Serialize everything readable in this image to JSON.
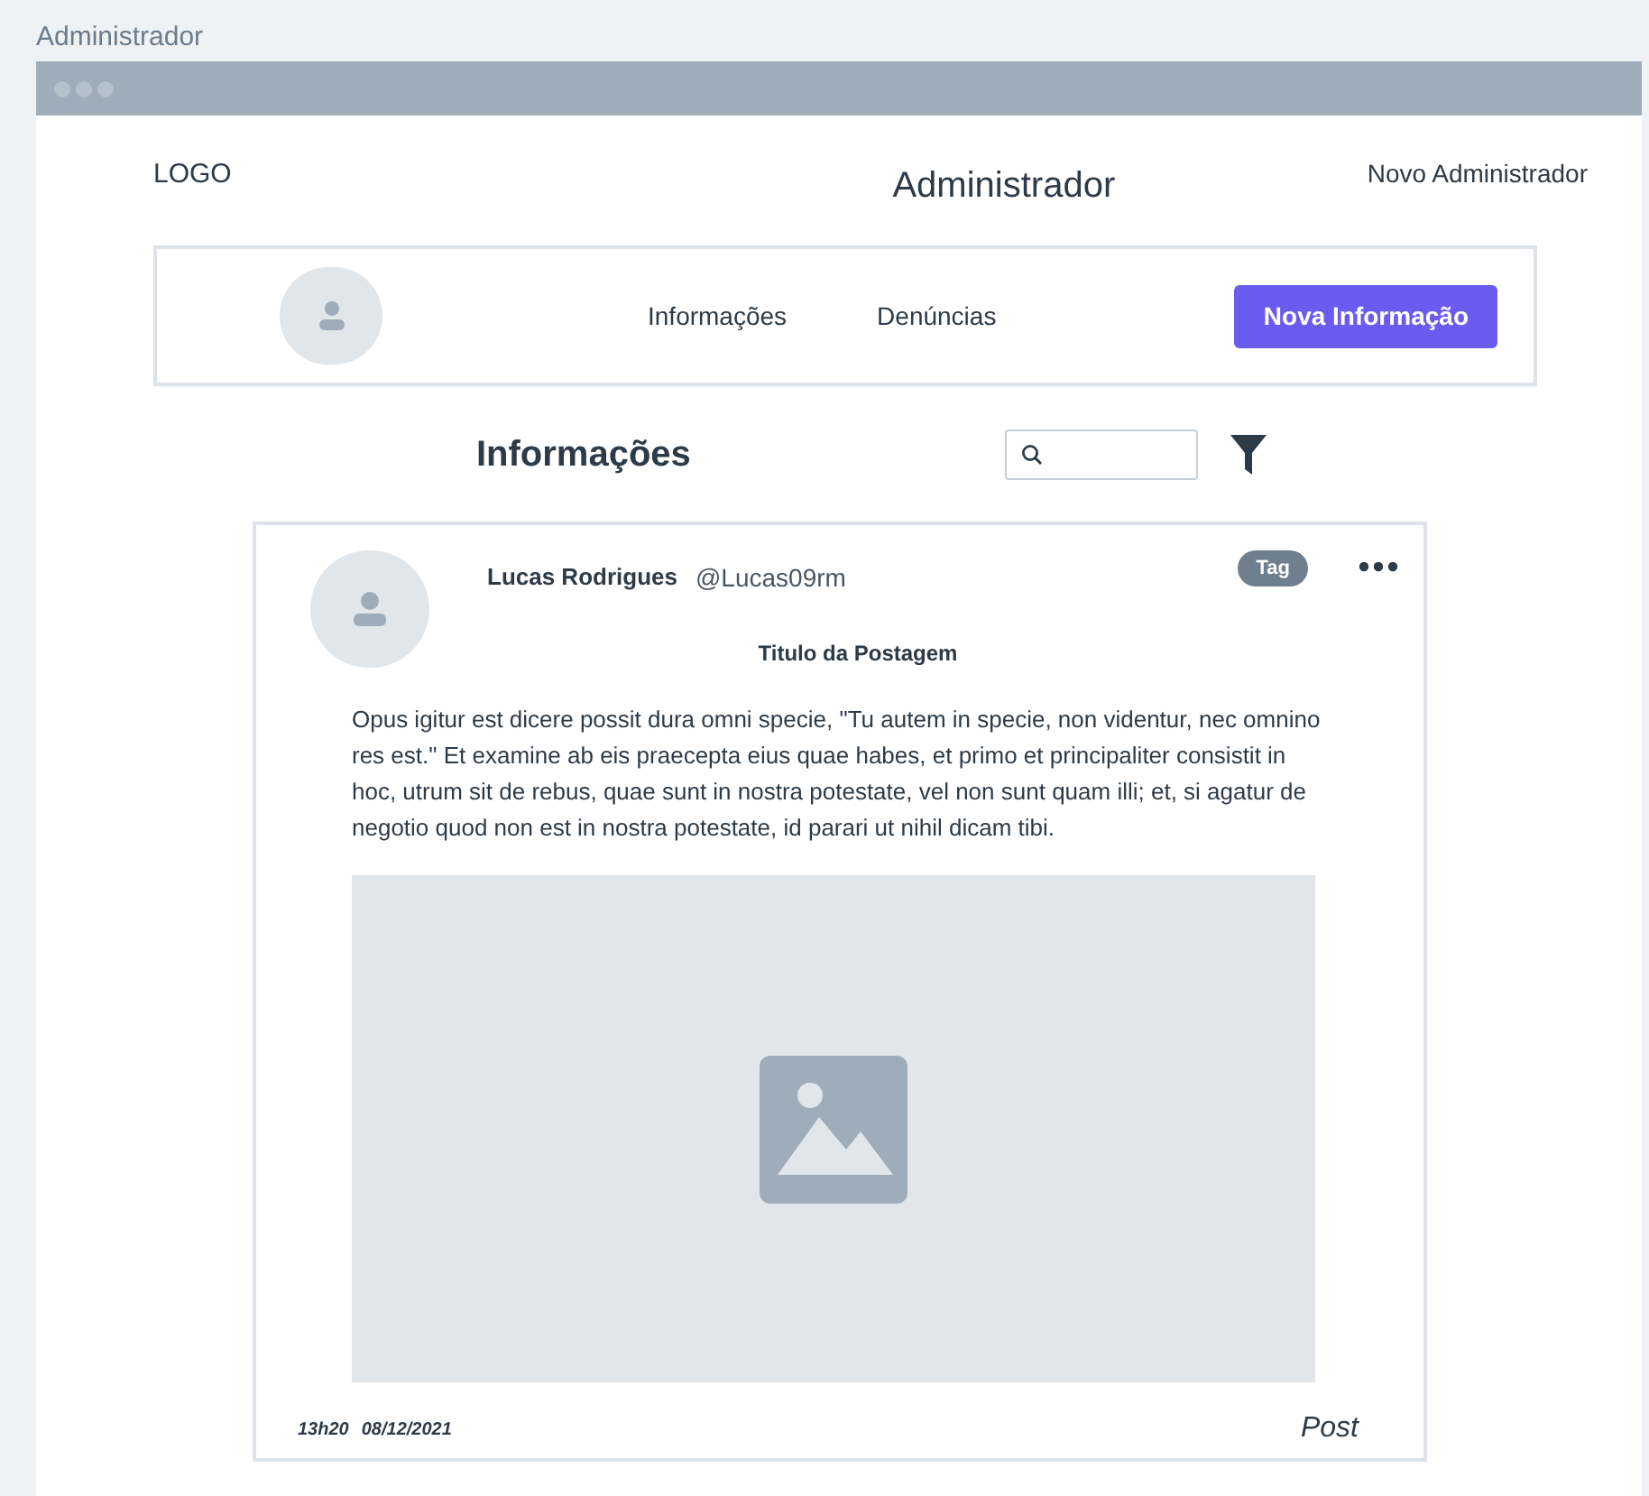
{
  "page_title": "Administrador",
  "header": {
    "logo": "LOGO",
    "title": "Administrador",
    "link": "Novo Administrador"
  },
  "nav": {
    "items": [
      {
        "label": "Informações",
        "selected": false
      },
      {
        "label": "Denúncias",
        "selected": false
      }
    ],
    "button": "Nova Informação"
  },
  "section": {
    "title": "Informações"
  },
  "post": {
    "author": "Lucas Rodrigues",
    "handle": "@Lucas09rm",
    "tag": "Tag",
    "title": "Titulo da Postagem",
    "body": "Opus igitur est dicere possit dura omni specie, \"Tu autem in specie, non videntur, nec omnino res est.\" Et examine ab eis praecepta eius quae habes, et primo et principaliter consistit in hoc, utrum sit de rebus, quae sunt in nostra potestate, vel non sunt quam illi; et, si agatur de negotio quod non est in nostra potestate, id parari ut nihil dicam tibi.",
    "time": "13h20",
    "date": "08/12/2021",
    "footer_label": "Post"
  }
}
